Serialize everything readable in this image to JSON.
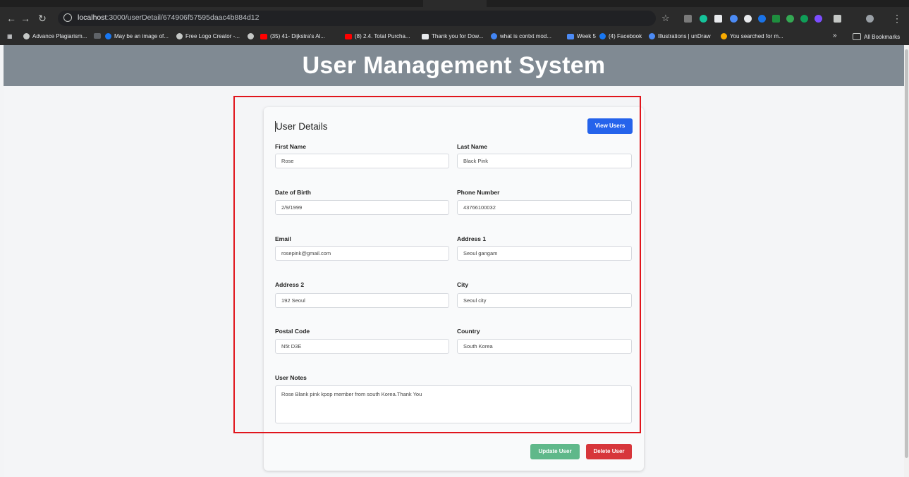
{
  "browser": {
    "url_host": "localhost",
    "url_rest": ":3000/userDetail/674906f57595daac4b884d12",
    "bookmarks": [
      "Advance Plagiarism...",
      "May be an image of...",
      "Free Logo Creator -...",
      "(35) 41- Dijkstra's Al...",
      "(8) 2.4. Total Purcha...",
      "Thank you for Dow...",
      "what is contxt mod...",
      "Week 5",
      "(4) Facebook",
      "Illustrations | unDraw",
      "You searched for m..."
    ],
    "more_chevron": "»",
    "all_bookmarks": "All Bookmarks"
  },
  "header": {
    "title": "User Management System"
  },
  "card": {
    "title": "User Details",
    "view_users_label": "View Users",
    "update_label": "Update User",
    "delete_label": "Delete User"
  },
  "fields": {
    "first_name": {
      "label": "First Name",
      "value": "Rose"
    },
    "last_name": {
      "label": "Last Name",
      "value": "Black Pink"
    },
    "dob": {
      "label": "Date of Birth",
      "value": "2/9/1999"
    },
    "phone": {
      "label": "Phone Number",
      "value": "43766100032"
    },
    "email": {
      "label": "Email",
      "value": "rosepink@gmail.com"
    },
    "address1": {
      "label": "Address 1",
      "value": "Seoul gangam"
    },
    "address2": {
      "label": "Address 2",
      "value": "192 Seoul"
    },
    "city": {
      "label": "City",
      "value": "Seoul city"
    },
    "postal": {
      "label": "Postal Code",
      "value": "N5t D3E"
    },
    "country": {
      "label": "Country",
      "value": "South Korea"
    },
    "notes": {
      "label": "User Notes",
      "value": "Rose Blank pink kpop member from south Korea.Thank You"
    }
  },
  "colors": {
    "header_bg": "#808a93",
    "primary": "#2563eb",
    "success": "#5fb88a",
    "danger": "#d7363b",
    "highlight": "#e0151c"
  }
}
